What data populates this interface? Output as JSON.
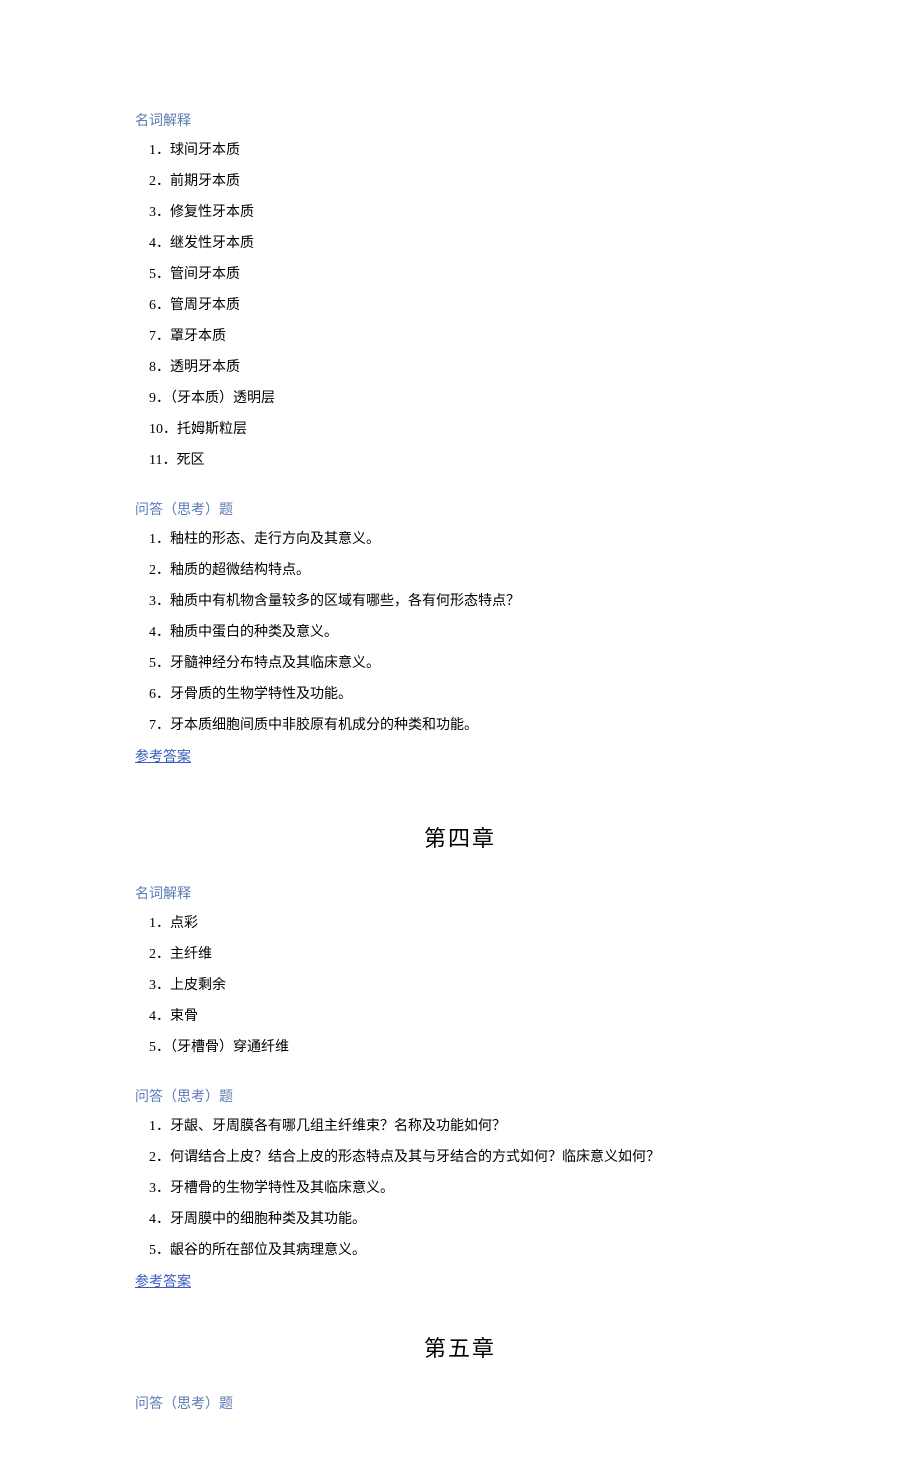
{
  "sections": [
    {
      "heading": "名词解释",
      "items": [
        "1．球间牙本质",
        "2．前期牙本质",
        "3．修复性牙本质",
        "4．继发性牙本质",
        "5．管间牙本质",
        "6．管周牙本质",
        "7．罩牙本质",
        "8．透明牙本质",
        "9．（牙本质）透明层",
        "10．托姆斯粒层",
        "11．死区"
      ]
    },
    {
      "heading": "问答（思考）题",
      "items": [
        "1．釉柱的形态、走行方向及其意义。",
        "2．釉质的超微结构特点。",
        "3．釉质中有机物含量较多的区域有哪些，各有何形态特点？",
        "4．釉质中蛋白的种类及意义。",
        "5．牙髓神经分布特点及其临床意义。",
        "6．牙骨质的生物学特性及功能。",
        "7．牙本质细胞间质中非胶原有机成分的种类和功能。"
      ],
      "answer_link": "参考答案"
    }
  ],
  "chapter4_title": "第四章",
  "chapter4_sections": [
    {
      "heading": "名词解释",
      "items": [
        "1．点彩",
        "2．主纤维",
        "3．上皮剩余",
        "4．束骨",
        "5．（牙槽骨）穿通纤维"
      ]
    },
    {
      "heading": "问答（思考）题",
      "items": [
        "1．牙龈、牙周膜各有哪几组主纤维束？名称及功能如何？",
        "2．何谓结合上皮？结合上皮的形态特点及其与牙结合的方式如何？临床意义如何？",
        "3．牙槽骨的生物学特性及其临床意义。",
        "4．牙周膜中的细胞种类及其功能。",
        "5．龈谷的所在部位及其病理意义。"
      ],
      "answer_link": "参考答案"
    }
  ],
  "chapter5_title": "第五章",
  "chapter5_heading": "问答（思考）题"
}
